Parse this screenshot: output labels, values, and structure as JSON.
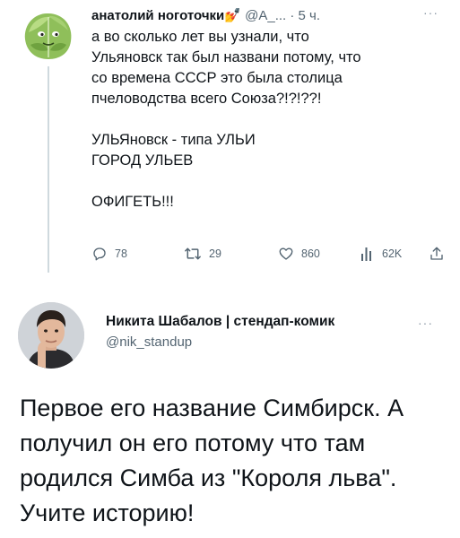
{
  "tweet1": {
    "author_name": "анатолий ноготочки",
    "author_emoji": "💅",
    "handle": "@А_...",
    "separator": "·",
    "time": "5 ч.",
    "more": "···",
    "paragraphs": [
      "а во сколько лет вы узнали, что\nУльяновск так был назвaни потому, что\nсо времена СССР это была столица\nпчеловодства всего Союза?!?!??!",
      "УЛЬЯновск -  типа УЛЬИ\nГОРОД УЛЬЕВ",
      "ОФИГЕТЬ!!!"
    ],
    "actions": {
      "replies": "78",
      "retweets": "29",
      "likes": "860",
      "views": "62K"
    }
  },
  "tweet2": {
    "author_name": "Никита Шабалов | стендап-комик",
    "handle": "@nik_standup",
    "more": "···",
    "paragraph": "Первое его название Симбирск. А\nполучил он его потому что там\nродился Симба из \"Короля льва\".\nУчите историю!"
  }
}
